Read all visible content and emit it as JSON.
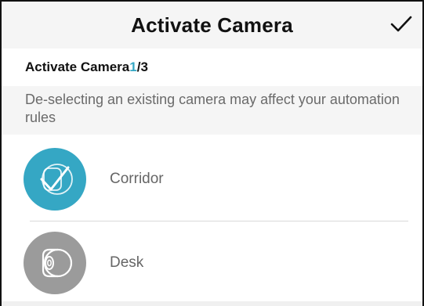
{
  "header": {
    "title": "Activate Camera",
    "confirm_icon": "checkmark-icon"
  },
  "section": {
    "title_prefix": "Activate Camera ",
    "step_current": "1",
    "step_rest": "/3",
    "notice": "De-selecting an existing camera may affect your automation rules"
  },
  "cameras": [
    {
      "name": "Corridor",
      "selected": true,
      "icon": "camera-check-icon"
    },
    {
      "name": "Desk",
      "selected": false,
      "icon": "camera-icon"
    }
  ],
  "colors": {
    "accent": "#35a7c4",
    "unselected": "#9b9b9b"
  }
}
